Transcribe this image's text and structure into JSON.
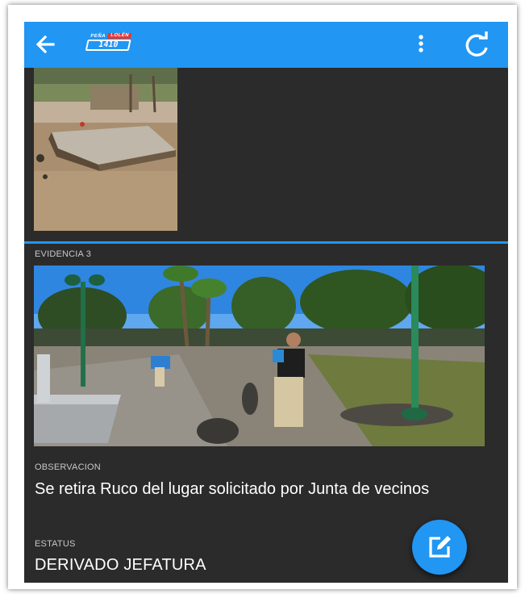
{
  "appbar": {
    "back_icon": "arrow-left-icon",
    "logo_top_left": "PEÑA",
    "logo_top_right": "LOLÉN",
    "logo_number": "1410",
    "menu_icon": "more-vert-icon",
    "refresh_icon": "refresh-icon",
    "color": "#2196f3"
  },
  "evidence_3": {
    "label": "EVIDENCIA 3"
  },
  "observation": {
    "label": "OBSERVACION",
    "text": "Se retira Ruco del lugar solicitado por Junta de vecinos"
  },
  "status": {
    "label": "ESTATUS",
    "value": "DERIVADO JEFATURA"
  },
  "fab": {
    "icon": "edit-icon"
  }
}
